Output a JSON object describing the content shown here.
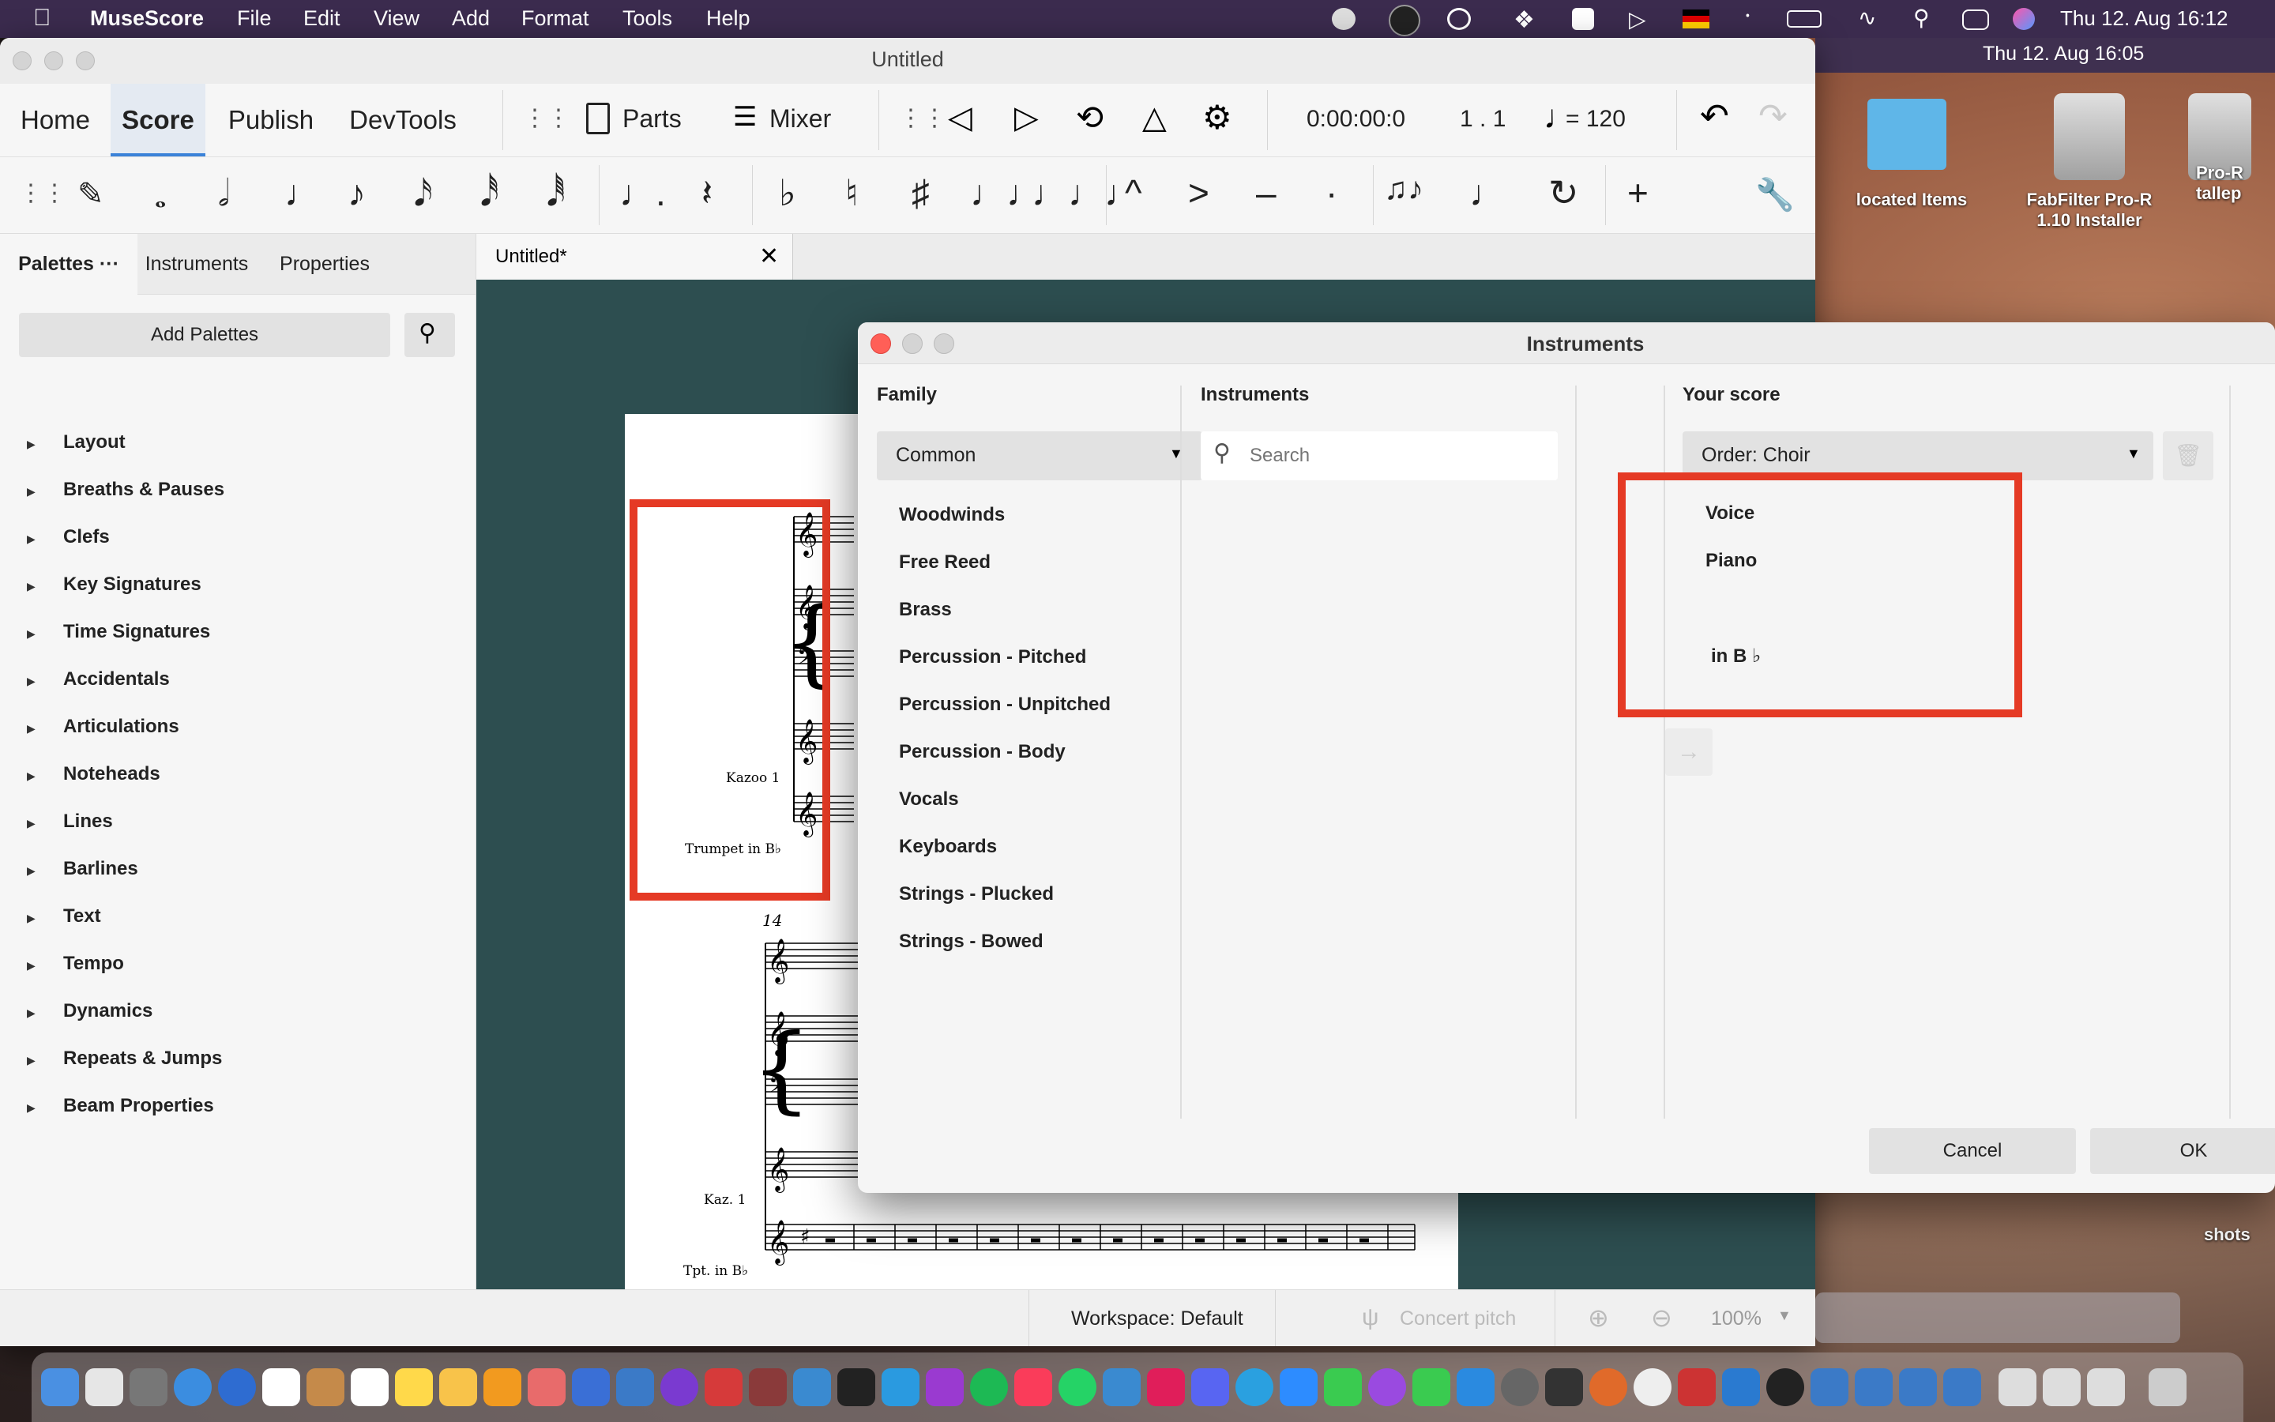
{
  "menubar": {
    "app_name": "MuseScore",
    "items": [
      "File",
      "Edit",
      "View",
      "Add",
      "Format",
      "Tools",
      "Help"
    ],
    "datetime": "Thu 12. Aug  16:12"
  },
  "desktop": {
    "secondary_clock": "Thu 12. Aug  16:05",
    "icons": [
      {
        "label": "located Items"
      },
      {
        "label": "FabFilter Pro-R 1.10 Installer"
      },
      {
        "label": "Pro-R tallер"
      }
    ],
    "shots_label": "shots"
  },
  "window": {
    "title": "Untitled",
    "tabs": [
      "Home",
      "Score",
      "Publish",
      "DevTools"
    ],
    "active_tab": "Score",
    "parts_label": "Parts",
    "mixer_label": "Mixer",
    "time_display": "0:00:00:0",
    "position_display": "1 . 1",
    "tempo_display": "= 120"
  },
  "palettes": {
    "tabs": [
      "Palettes",
      "Instruments",
      "Properties"
    ],
    "more": "···",
    "add_label": "Add Palettes",
    "items": [
      "Layout",
      "Breaths & Pauses",
      "Clefs",
      "Key Signatures",
      "Time Signatures",
      "Accidentals",
      "Articulations",
      "Noteheads",
      "Lines",
      "Barlines",
      "Text",
      "Tempo",
      "Dynamics",
      "Repeats & Jumps",
      "Beam Properties"
    ]
  },
  "score": {
    "tab_label": "Untitled*",
    "staff_labels": [
      "Kazoo 1",
      "Trumpet in B♭"
    ],
    "short_labels": [
      "Kaz. 1",
      "Tpt. in B♭"
    ],
    "measure_number": "14"
  },
  "statusbar": {
    "workspace": "Workspace: Default",
    "concert_pitch": "Concert pitch",
    "zoom": "100%"
  },
  "dialog": {
    "title": "Instruments",
    "family_header": "Family",
    "instruments_header": "Instruments",
    "your_score_header": "Your score",
    "family_selected": "Common",
    "families": [
      "Woodwinds",
      "Free Reed",
      "Brass",
      "Percussion - Pitched",
      "Percussion - Unpitched",
      "Percussion - Body",
      "Vocals",
      "Keyboards",
      "Strings - Plucked",
      "Strings - Bowed"
    ],
    "search_placeholder": "Search",
    "order_label": "Order: Choir",
    "score_items": [
      "Voice",
      "Piano",
      "in B ♭"
    ],
    "cancel": "Cancel",
    "ok": "OK"
  },
  "colors": {
    "menubar": "#3b2b4e",
    "score_bg": "#2d4e50",
    "highlight": "#e53a25",
    "accent": "#3a82d8"
  }
}
